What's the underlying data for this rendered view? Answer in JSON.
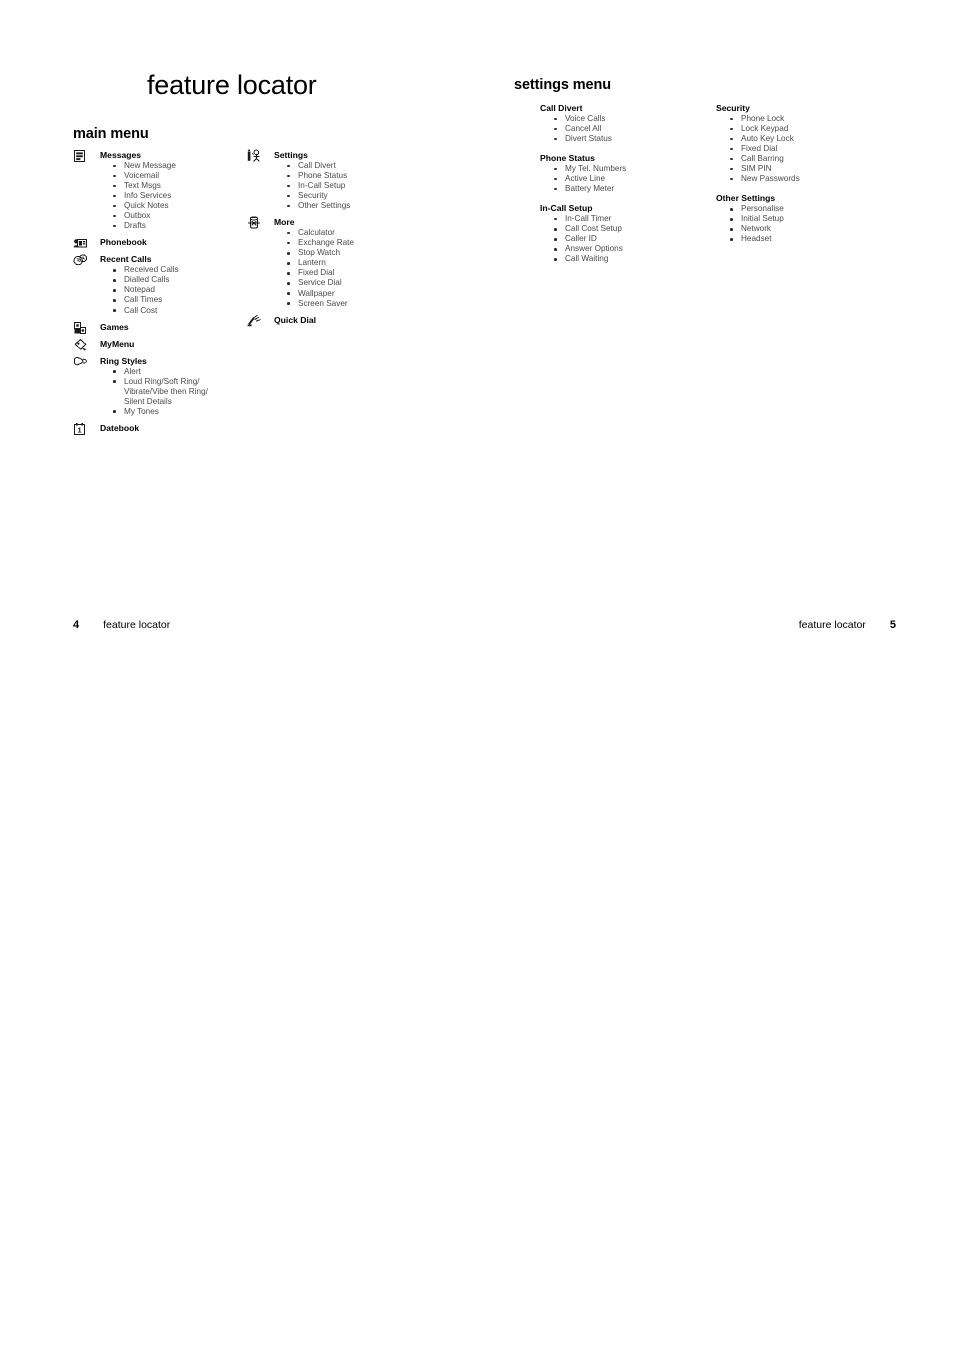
{
  "document": {
    "chapter_title": "feature locator"
  },
  "sections": {
    "main_menu_title": "main menu",
    "settings_menu_title": "settings menu"
  },
  "main_menu": {
    "column_left": [
      {
        "icon": "messages-icon",
        "label": "Messages",
        "items": [
          "New Message",
          "Voicemail",
          "Text Msgs",
          "Info Services",
          "Quick Notes",
          "Outbox",
          "Drafts"
        ]
      },
      {
        "icon": "phonebook-icon",
        "label": "Phonebook",
        "items": []
      },
      {
        "icon": "recent-calls-icon",
        "label": "Recent Calls",
        "items": [
          "Received Calls",
          "Dialled Calls",
          "Notepad",
          "Call Times",
          "Call Cost"
        ]
      },
      {
        "icon": "games-icon",
        "label": "Games",
        "items": []
      },
      {
        "icon": "mymenu-icon",
        "label": "MyMenu",
        "items": []
      },
      {
        "icon": "ring-styles-icon",
        "label": "Ring Styles",
        "items": [
          "Alert",
          "Loud Ring/Soft Ring/\nVibrate/Vibe then Ring/\nSilent Details",
          "My Tones"
        ]
      },
      {
        "icon": "datebook-icon",
        "label": "Datebook",
        "items": []
      }
    ],
    "column_right": [
      {
        "icon": "settings-icon",
        "label": "Settings",
        "items": [
          "Call Divert",
          "Phone Status",
          "In-Call Setup",
          "Security",
          "Other Settings"
        ]
      },
      {
        "icon": "more-icon",
        "label": "More",
        "items": [
          "Calculator",
          "Exchange Rate",
          "Stop Watch",
          "Lantern",
          "Fixed Dial",
          "Service Dial",
          "Wallpaper",
          "Screen Saver"
        ]
      },
      {
        "icon": "quick-dial-icon",
        "label": "Quick Dial",
        "items": []
      }
    ]
  },
  "settings_menu": {
    "column_left": [
      {
        "label": "Call Divert",
        "items": [
          "Voice Calls",
          "Cancel All",
          "Divert Status"
        ]
      },
      {
        "label": "Phone Status",
        "items": [
          "My Tel. Numbers",
          "Active Line",
          "Battery Meter"
        ]
      },
      {
        "label": "In-Call Setup",
        "items": [
          "In-Call Timer",
          "Call Cost Setup",
          "Caller ID",
          "Answer Options",
          "Call Waiting"
        ]
      }
    ],
    "column_right": [
      {
        "label": "Security",
        "items": [
          "Phone Lock",
          "Lock Keypad",
          "Auto Key Lock",
          "Fixed Dial",
          "Call Barring",
          "SIM PIN",
          "New Passwords"
        ]
      },
      {
        "label": "Other Settings",
        "items": [
          "Personalise",
          "Initial Setup",
          "Network",
          "Headset"
        ]
      }
    ]
  },
  "footer": {
    "left_folio": "4",
    "left_label": "feature locator",
    "right_label": "feature locator",
    "right_folio": "5"
  },
  "colors": {
    "text": "#000000",
    "bullet_text": "#4b4b4b",
    "background": "#ffffff"
  }
}
